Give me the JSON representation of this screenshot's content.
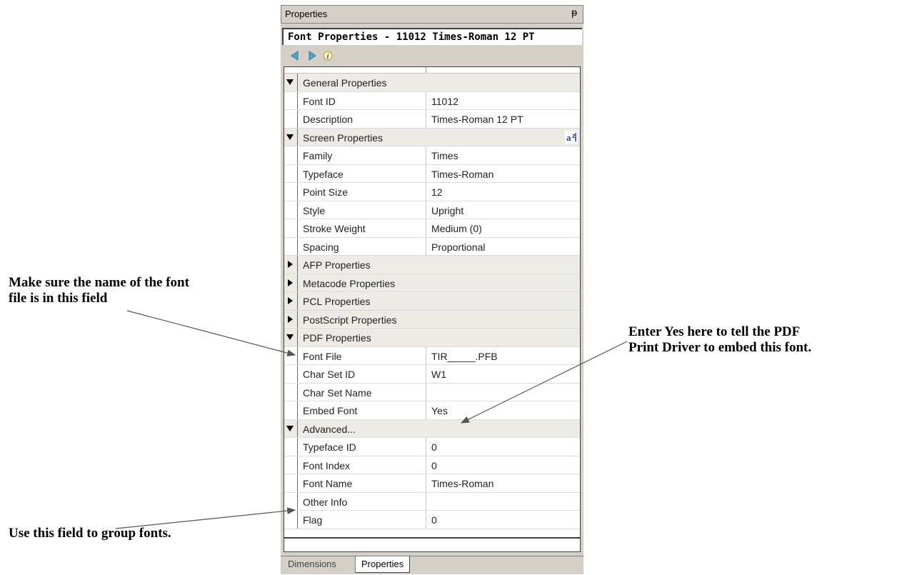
{
  "panel": {
    "title": "Properties",
    "pin_glyph": "ᵽ",
    "header": "Font Properties - 11012  Times-Roman 12 PT",
    "toolbar": {
      "back_icon": "left-arrow-icon",
      "forward_icon": "right-arrow-icon",
      "info_icon": "info-icon"
    }
  },
  "rows": [
    {
      "type": "category",
      "label": "General Properties",
      "expanded": true
    },
    {
      "type": "field",
      "label": "Font ID",
      "value": "11012"
    },
    {
      "type": "field",
      "label": "Description",
      "value": "Times-Roman 12 PT"
    },
    {
      "type": "category",
      "label": "Screen Properties",
      "expanded": true,
      "sort_icon": true
    },
    {
      "type": "field",
      "label": "Family",
      "value": "Times"
    },
    {
      "type": "field",
      "label": "Typeface",
      "value": "Times-Roman"
    },
    {
      "type": "field",
      "label": "Point Size",
      "value": "12"
    },
    {
      "type": "field",
      "label": "Style",
      "value": "Upright"
    },
    {
      "type": "field",
      "label": "Stroke Weight",
      "value": "Medium (0)"
    },
    {
      "type": "field",
      "label": "Spacing",
      "value": "Proportional"
    },
    {
      "type": "category",
      "label": "AFP Properties",
      "expanded": false
    },
    {
      "type": "category",
      "label": "Metacode Properties",
      "expanded": false
    },
    {
      "type": "category",
      "label": "PCL Properties",
      "expanded": false
    },
    {
      "type": "category",
      "label": "PostScript Properties",
      "expanded": false
    },
    {
      "type": "category",
      "label": "PDF Properties",
      "expanded": true
    },
    {
      "type": "field",
      "label": "Font File",
      "value": "TIR_____.PFB"
    },
    {
      "type": "field",
      "label": "Char Set ID",
      "value": "W1"
    },
    {
      "type": "field",
      "label": "Char Set Name",
      "value": ""
    },
    {
      "type": "field",
      "label": "Embed Font",
      "value": "Yes"
    },
    {
      "type": "category",
      "label": "Advanced...",
      "expanded": true
    },
    {
      "type": "field",
      "label": "Typeface ID",
      "value": "0"
    },
    {
      "type": "field",
      "label": "Font Index",
      "value": "0"
    },
    {
      "type": "field",
      "label": "Font Name",
      "value": "Times-Roman"
    },
    {
      "type": "field",
      "label": "Other Info",
      "value": ""
    },
    {
      "type": "field",
      "label": "Flag",
      "value": "0"
    }
  ],
  "tabs": [
    {
      "label": "Dimensions",
      "active": false
    },
    {
      "label": "Properties",
      "active": true
    }
  ],
  "annotations": {
    "font_file_note_line1": "Make sure the name of the font",
    "font_file_note_line2": "file is in this field",
    "embed_note_line1": "Enter Yes here to tell the PDF",
    "embed_note_line2": "Print Driver to embed this font.",
    "group_note": "Use this field to group fonts."
  },
  "colors": {
    "panel_bg": "#d4d0c8",
    "category_bg": "#ecebe6",
    "nav_arrow": "#4aa8c8"
  }
}
